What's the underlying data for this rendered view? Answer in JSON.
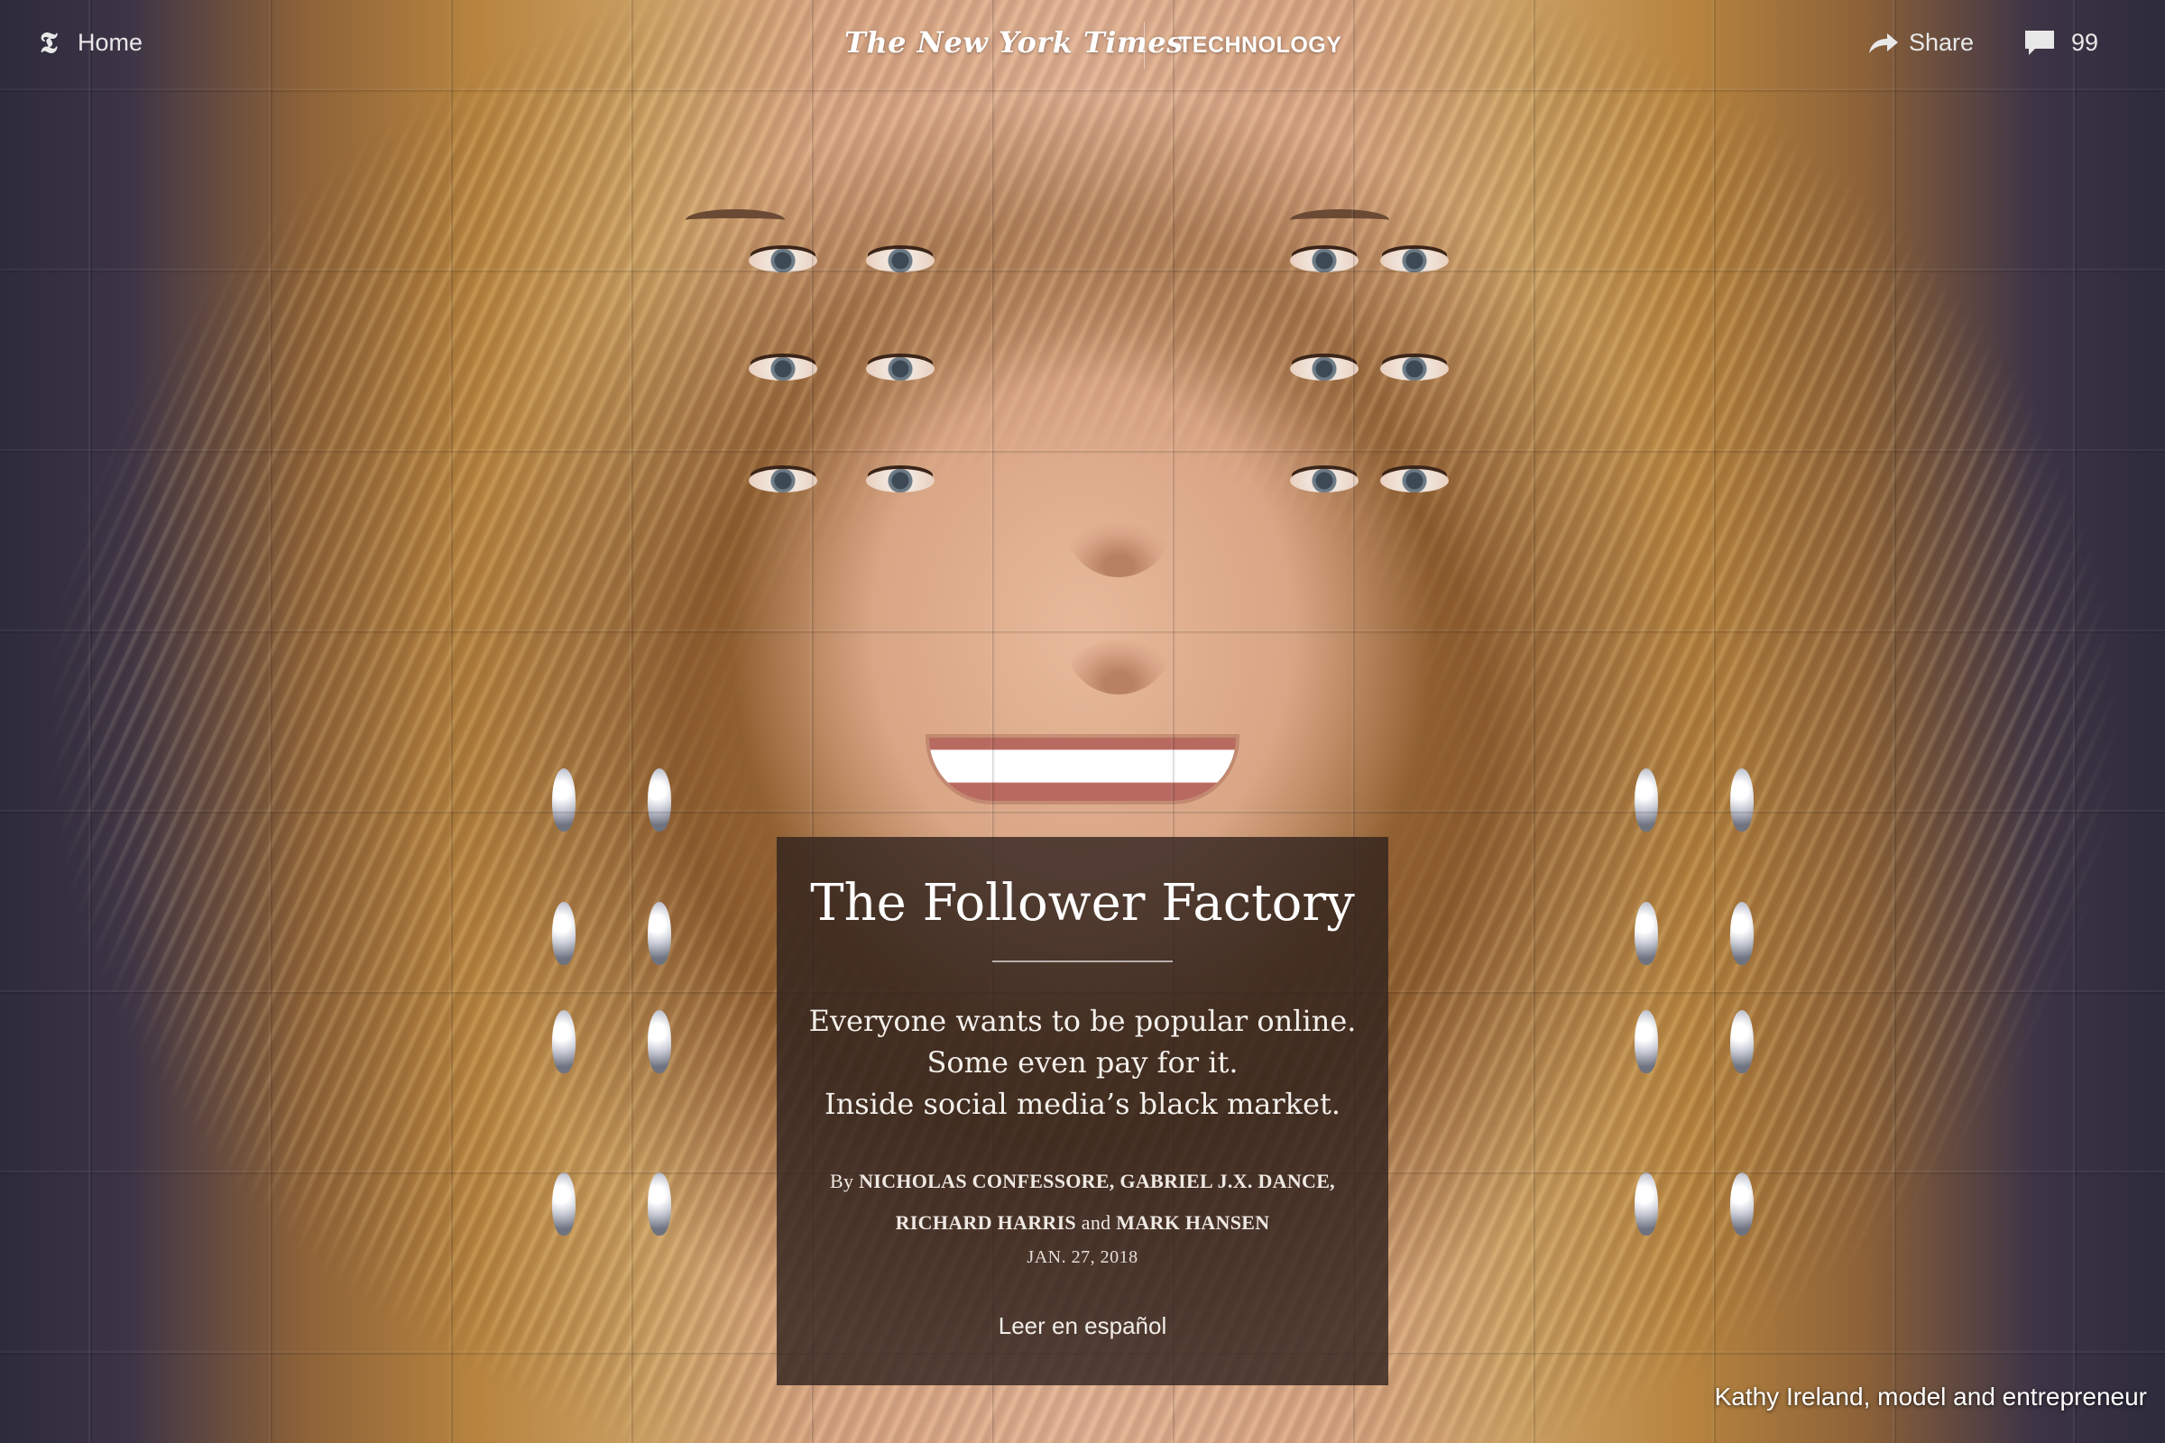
{
  "topbar": {
    "home_label": "Home",
    "logo_glyph": "𝕿",
    "masthead": "The New York Times",
    "section": "TECHNOLOGY",
    "share_label": "Share",
    "comment_count": "99"
  },
  "article": {
    "headline": "The Follower Factory",
    "dek_lines": [
      "Everyone wants to be popular online.",
      "Some even pay for it.",
      "Inside social media’s black market."
    ],
    "byline": {
      "by": "By",
      "line1_authors": "NICHOLAS CONFESSORE, GABRIEL J.X. DANCE,",
      "line2_author_a": "RICHARD HARRIS",
      "and": "and",
      "line2_author_b": "MARK HANSEN"
    },
    "date": "JAN. 27, 2018",
    "language_link": "Leer en español"
  },
  "caption": "Kathy Ireland, model and entrepreneur",
  "icons": {
    "home": "nyt-t-icon",
    "share": "share-arrow-icon",
    "comments": "comment-bubble-icon"
  },
  "colors": {
    "background": "#2f2d3f",
    "card_background": "rgba(48, 34, 30, 0.80)",
    "text": "#ffffff"
  }
}
